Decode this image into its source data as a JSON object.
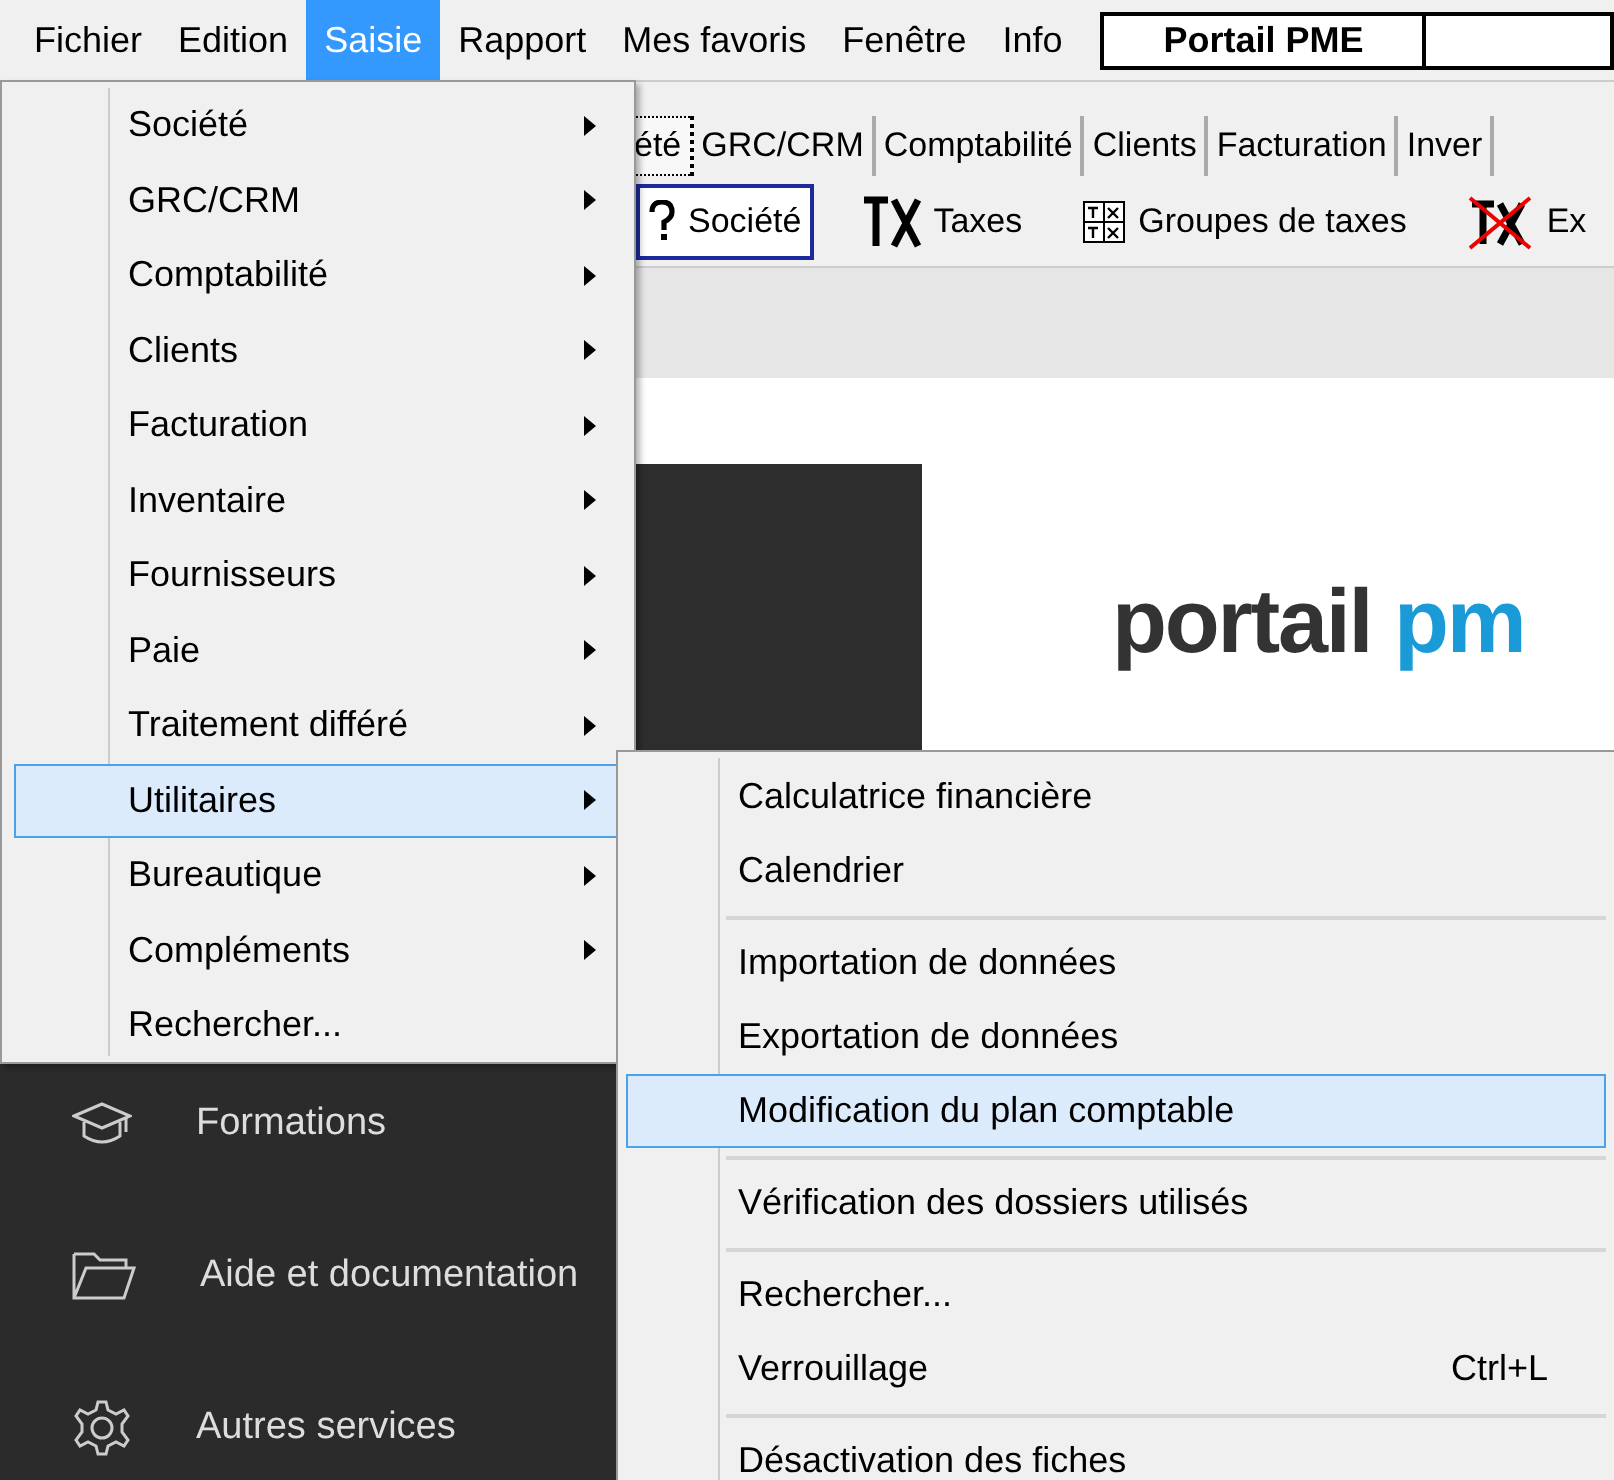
{
  "menu_bar": {
    "items": [
      {
        "label": "Fichier",
        "selected": false
      },
      {
        "label": "Edition",
        "selected": false
      },
      {
        "label": "Saisie",
        "selected": true
      },
      {
        "label": "Rapport",
        "selected": false
      },
      {
        "label": "Mes favoris",
        "selected": false
      },
      {
        "label": "Fenêtre",
        "selected": false
      },
      {
        "label": "Info",
        "selected": false
      }
    ],
    "portal_field": "Portail PME"
  },
  "tabs": [
    {
      "label": "été",
      "selected": true
    },
    {
      "label": "GRC/CRM",
      "selected": false
    },
    {
      "label": "Comptabilité",
      "selected": false
    },
    {
      "label": "Clients",
      "selected": false
    },
    {
      "label": "Facturation",
      "selected": false
    },
    {
      "label": "Inver",
      "selected": false
    }
  ],
  "toolbar": [
    {
      "label": "Société",
      "selected": true
    },
    {
      "label": "Taxes",
      "selected": false
    },
    {
      "label": "Groupes de taxes",
      "selected": false
    },
    {
      "label": "Ex",
      "selected": false
    }
  ],
  "portal": {
    "logo_dark": "portail",
    "logo_blue": "pm"
  },
  "sidebar": [
    {
      "label": "Formations"
    },
    {
      "label": "Aide et documentation"
    },
    {
      "label": "Autres services"
    }
  ],
  "saisie_menu": [
    {
      "kind": "submenu",
      "label": "Société",
      "selected": false
    },
    {
      "kind": "submenu",
      "label": "GRC/CRM",
      "selected": false
    },
    {
      "kind": "submenu",
      "label": "Comptabilité",
      "selected": false
    },
    {
      "kind": "submenu",
      "label": "Clients",
      "selected": false
    },
    {
      "kind": "submenu",
      "label": "Facturation",
      "selected": false
    },
    {
      "kind": "submenu",
      "label": "Inventaire",
      "selected": false
    },
    {
      "kind": "submenu",
      "label": "Fournisseurs",
      "selected": false
    },
    {
      "kind": "submenu",
      "label": "Paie",
      "selected": false
    },
    {
      "kind": "submenu",
      "label": "Traitement différé",
      "selected": false
    },
    {
      "kind": "submenu",
      "label": "Utilitaires",
      "selected": true
    },
    {
      "kind": "submenu",
      "label": "Bureautique",
      "selected": false
    },
    {
      "kind": "submenu",
      "label": "Compléments",
      "selected": false
    },
    {
      "kind": "command",
      "label": "Rechercher...",
      "selected": false
    }
  ],
  "utilitaires_menu": [
    {
      "kind": "item",
      "label": "Calculatrice financière",
      "selected": false
    },
    {
      "kind": "item",
      "label": "Calendrier",
      "selected": false
    },
    {
      "kind": "separator"
    },
    {
      "kind": "item",
      "label": "Importation de données",
      "selected": false
    },
    {
      "kind": "item",
      "label": "Exportation de données",
      "selected": false
    },
    {
      "kind": "item",
      "label": "Modification du plan comptable",
      "selected": true
    },
    {
      "kind": "separator"
    },
    {
      "kind": "item",
      "label": "Vérification des dossiers utilisés",
      "selected": false
    },
    {
      "kind": "separator"
    },
    {
      "kind": "item",
      "label": "Rechercher...",
      "selected": false
    },
    {
      "kind": "item",
      "label": "Verrouillage",
      "shortcut": "Ctrl+L",
      "selected": false
    },
    {
      "kind": "separator"
    },
    {
      "kind": "item",
      "label": "Désactivation des fiches",
      "selected": false
    }
  ]
}
